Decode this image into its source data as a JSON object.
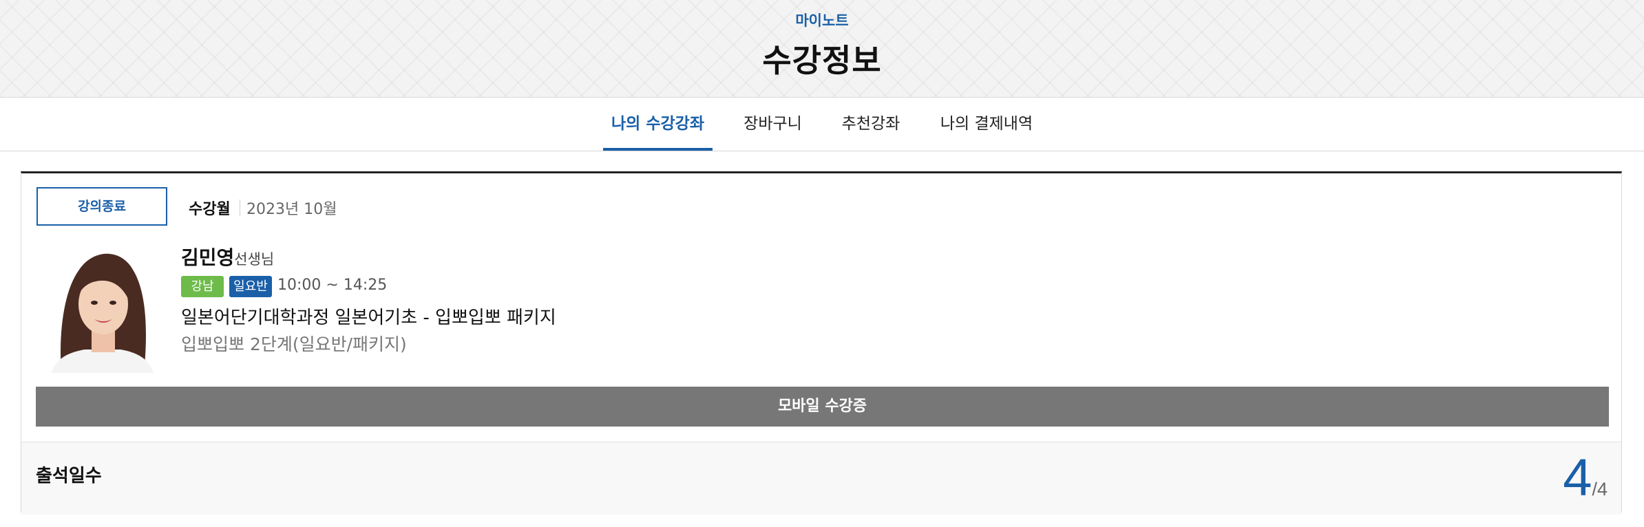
{
  "header": {
    "subtitle": "마이노트",
    "title": "수강정보"
  },
  "tabs": [
    {
      "label": "나의 수강강좌",
      "active": true
    },
    {
      "label": "장바구니",
      "active": false
    },
    {
      "label": "추천강좌",
      "active": false
    },
    {
      "label": "나의 결제내역",
      "active": false
    }
  ],
  "course_card": {
    "status": "강의종료",
    "month_label": "수강월",
    "month_value": "2023년 10월",
    "teacher_name": "김민영",
    "teacher_title": "선생님",
    "tags": [
      "강남",
      "일요반"
    ],
    "time": "10:00 ~ 14:25",
    "course_title": "일본어단기대학과정 일본어기초 - 입뽀입뽀 패키지",
    "course_subtitle": "입뽀입뽀 2단계(일요반/패키지)",
    "mobile_button": "모바일 수강증"
  },
  "attendance": {
    "label": "출석일수",
    "count": "4",
    "total": "/4"
  },
  "colors": {
    "accent": "#1a5fa8",
    "tag_green": "#6dbb4a",
    "button_gray": "#777777"
  }
}
